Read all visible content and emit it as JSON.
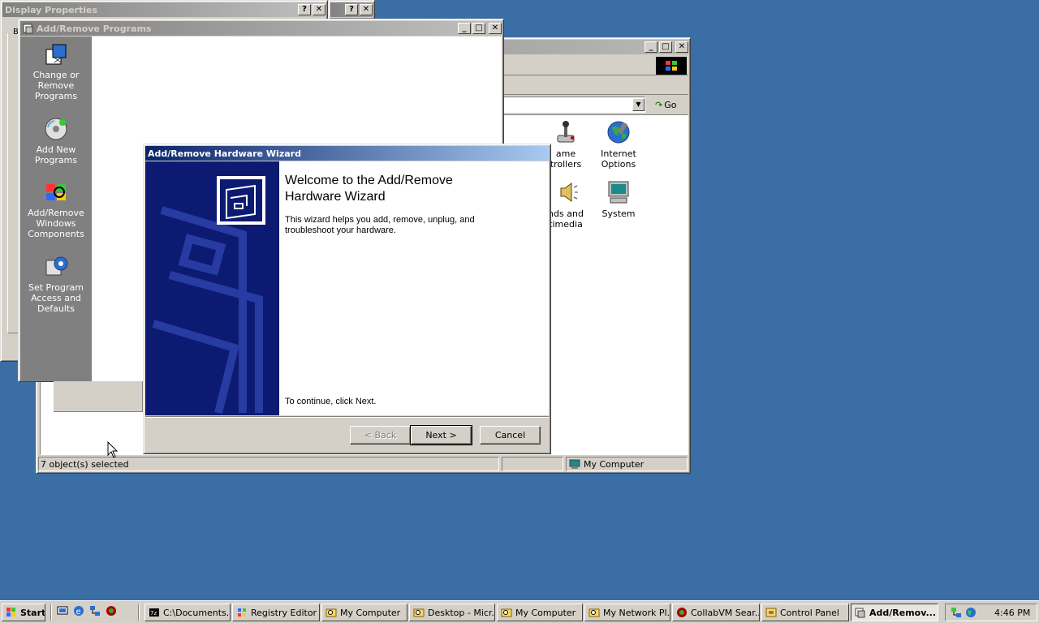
{
  "display_properties": {
    "title": "Display Properties",
    "help": "?",
    "close": "✕",
    "partial_label": "B"
  },
  "second_dialog": {
    "help": "?",
    "close": "✕"
  },
  "control_panel": {
    "address_go": "Go",
    "icons": [
      {
        "label": "ame\ntrollers"
      },
      {
        "label": "Internet\nOptions"
      },
      {
        "label": "nds and\ntimedia"
      },
      {
        "label": "System"
      }
    ],
    "status": {
      "selected": "7 object(s) selected",
      "location": "My Computer"
    }
  },
  "add_remove": {
    "title": "Add/Remove Programs",
    "sidebar": [
      {
        "label": "Change or\nRemove\nPrograms"
      },
      {
        "label": "Add New\nPrograms"
      },
      {
        "label": "Add/Remove\nWindows\nComponents"
      },
      {
        "label": "Set Program\nAccess and\nDefaults"
      }
    ]
  },
  "wizard": {
    "title": "Add/Remove Hardware Wizard",
    "heading": "Welcome to the Add/Remove\nHardware Wizard",
    "body": "This wizard helps you add, remove, unplug, and\ntroubleshoot your hardware.",
    "footer_text": "To continue, click Next.",
    "back_label": "< Back",
    "next_label": "Next >",
    "cancel_label": "Cancel"
  },
  "taskbar": {
    "start_label": "Start",
    "tasks": [
      {
        "label": "C:\\Documents..."
      },
      {
        "label": "Registry Editor"
      },
      {
        "label": "My Computer"
      },
      {
        "label": "Desktop - Micr..."
      },
      {
        "label": "My Computer"
      },
      {
        "label": "My Network Pl..."
      },
      {
        "label": "CollabVM Sear..."
      },
      {
        "label": "Control Panel"
      },
      {
        "label": "Add/Remov..."
      }
    ],
    "clock": "4:46 PM"
  },
  "colors": {
    "desktop": "#3a6ea5",
    "active_title": "#0a246a",
    "wizard_banner": "#0d1a72"
  }
}
